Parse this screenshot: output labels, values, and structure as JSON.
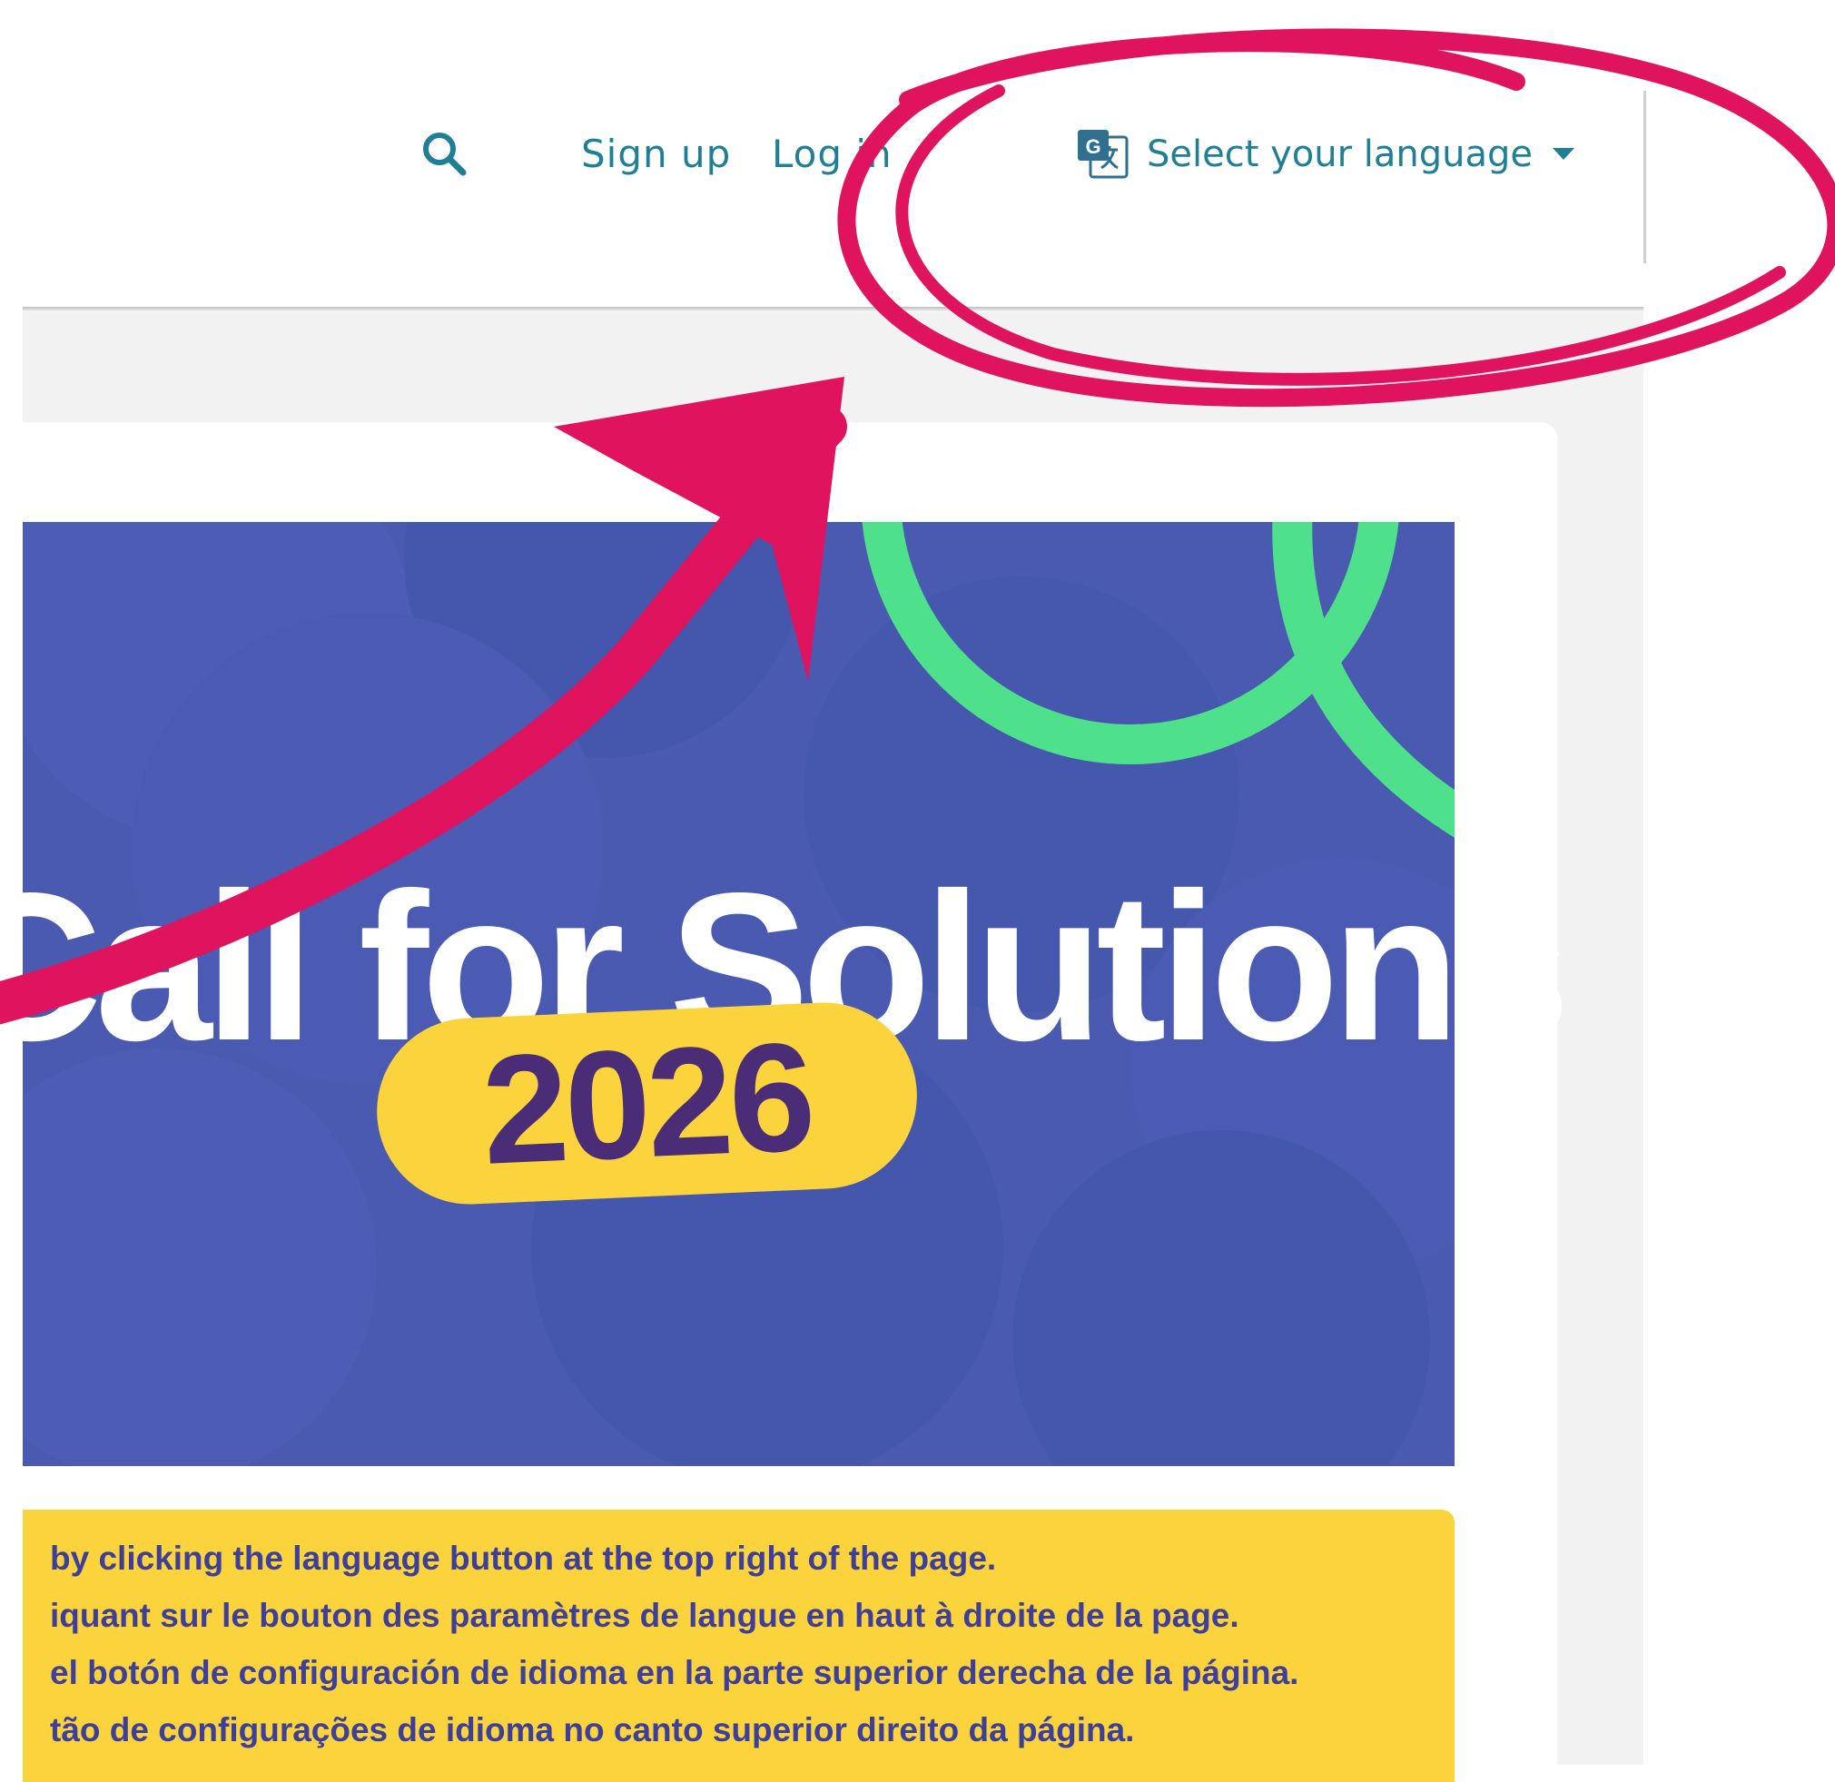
{
  "header": {
    "sign_up": "Sign up",
    "log_in": "Log in",
    "language_button": "Select your language"
  },
  "banner": {
    "title": "Call for Solutions",
    "year": "2026"
  },
  "notice": {
    "lines": [
      "by clicking the language button at the top right of the page.",
      "iquant sur le bouton des paramètres de langue en haut à droite de la page.",
      " el botón de configuración de idioma en la parte superior derecha de la página.",
      "tão de configurações de idioma no canto superior direito da página."
    ]
  },
  "colors": {
    "link": "#1f7f97",
    "banner_bg": "#4a5ab1",
    "accent_green": "#4ee08a",
    "badge_yellow": "#fbd33c",
    "year_purple": "#4b2d77",
    "annotation_pink": "#e0135f"
  },
  "icons": {
    "search": "search-icon",
    "translate": "translate-icon",
    "caret": "caret-down-icon"
  }
}
